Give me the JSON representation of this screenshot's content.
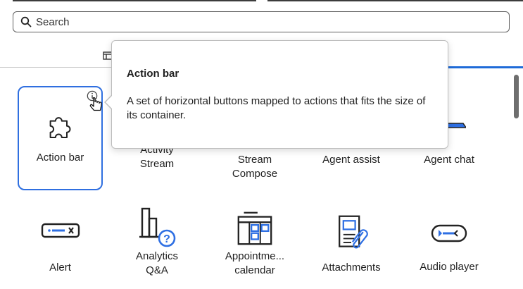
{
  "search": {
    "placeholder": "Search",
    "value": ""
  },
  "tooltip": {
    "title": "Action bar",
    "description": "A set of horizontal buttons mapped to actions that fits the size of its container."
  },
  "tiles": [
    {
      "label": "Action bar",
      "icon": "puzzle-piece-icon",
      "selected": true
    },
    {
      "label": "Activity\nStream",
      "icon": "activity-stream-icon"
    },
    {
      "label": "Stream\nCompose",
      "icon": "stream-compose-icon"
    },
    {
      "label": "Agent assist",
      "icon": "agent-assist-icon"
    },
    {
      "label": "Agent chat",
      "icon": "agent-chat-icon"
    },
    {
      "label": "Alert",
      "icon": "alert-icon"
    },
    {
      "label": "Analytics\nQ&A",
      "icon": "analytics-qa-icon"
    },
    {
      "label": "Appointme...\ncalendar",
      "icon": "appointment-calendar-icon"
    },
    {
      "label": "Attachments",
      "icon": "attachments-icon"
    },
    {
      "label": "Audio player",
      "icon": "audio-player-icon"
    }
  ],
  "colors": {
    "accent": "#2f6fe0",
    "tab_underline": "#1f6bd8",
    "icon_blue": "#2e6fe3"
  }
}
